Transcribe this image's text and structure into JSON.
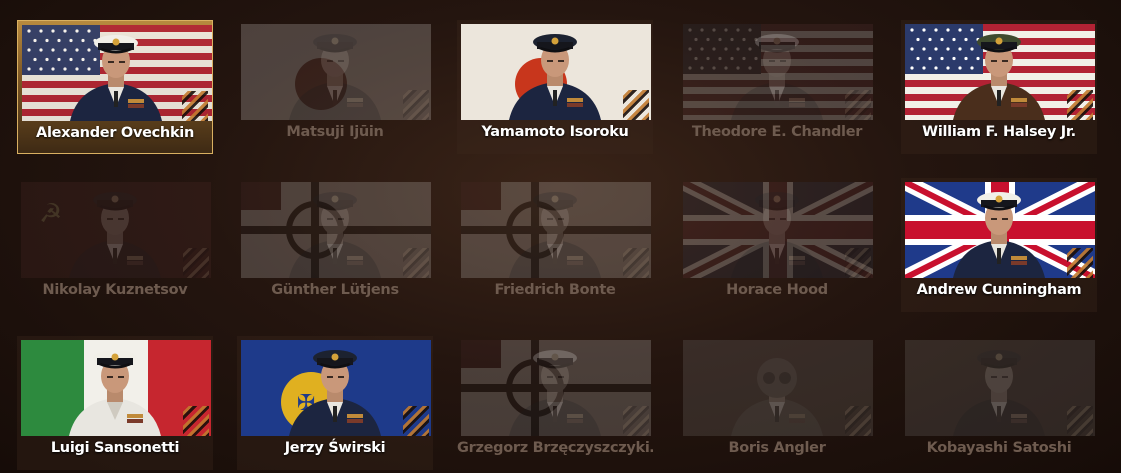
{
  "commanders": [
    {
      "name": "Alexander Ovechkin",
      "flag": "usa",
      "state": "selected",
      "uniform": "navy",
      "cap": "white"
    },
    {
      "name": "Matsuji Ijūin",
      "flag": "japan-naval",
      "state": "locked",
      "uniform": "dark",
      "cap": "dark"
    },
    {
      "name": "Yamamoto Isoroku",
      "flag": "japan-naval",
      "state": "unlocked",
      "uniform": "navy",
      "cap": "dark"
    },
    {
      "name": "Theodore E. Chandler",
      "flag": "usa",
      "state": "locked",
      "uniform": "dark",
      "cap": "white"
    },
    {
      "name": "William F. Halsey Jr.",
      "flag": "usa",
      "state": "unlocked",
      "uniform": "leather",
      "cap": "green"
    },
    {
      "name": "Nikolay Kuznetsov",
      "flag": "ussr",
      "state": "locked",
      "uniform": "dark",
      "cap": "dark"
    },
    {
      "name": "Günther Lütjens",
      "flag": "germany",
      "state": "locked",
      "uniform": "dark",
      "cap": "dark"
    },
    {
      "name": "Friedrich Bonte",
      "flag": "germany",
      "state": "locked",
      "uniform": "dark",
      "cap": "dark"
    },
    {
      "name": "Horace Hood",
      "flag": "uk",
      "state": "locked",
      "uniform": "dark",
      "cap": "dark"
    },
    {
      "name": "Andrew Cunningham",
      "flag": "uk",
      "state": "unlocked",
      "uniform": "navy",
      "cap": "white"
    },
    {
      "name": "Luigi Sansonetti",
      "flag": "italy",
      "state": "unlocked",
      "uniform": "white",
      "cap": "white"
    },
    {
      "name": "Jerzy Świrski",
      "flag": "poland-naval",
      "state": "unlocked",
      "uniform": "navy",
      "cap": "dark"
    },
    {
      "name": "Grzegorz Brzęczyszczyki…",
      "flag": "germany",
      "state": "locked",
      "uniform": "dark",
      "cap": "white"
    },
    {
      "name": "Boris Angler",
      "flag": "plain",
      "state": "locked",
      "uniform": "diver",
      "cap": "none"
    },
    {
      "name": "Kobayashi Satoshi",
      "flag": "plain",
      "state": "locked",
      "uniform": "dark",
      "cap": "dark"
    }
  ],
  "colors": {
    "selected_border": "#d9b061",
    "name_active": "#ffffff",
    "name_locked": "#6e5b4f",
    "stripe_accent": "#c27a2e"
  }
}
